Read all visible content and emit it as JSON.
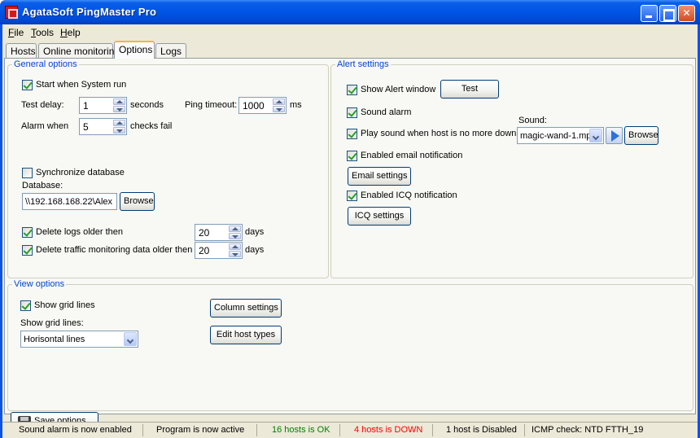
{
  "window": {
    "title": "AgataSoft PingMaster Pro"
  },
  "menu": [
    "File",
    "Tools",
    "Help"
  ],
  "tabs": [
    {
      "label": "Hosts",
      "active": false
    },
    {
      "label": "Online monitoring",
      "active": false
    },
    {
      "label": "Options",
      "active": true
    },
    {
      "label": "Logs",
      "active": false
    }
  ],
  "general": {
    "title": "General options",
    "start_when_system_run": {
      "label": "Start when System run",
      "checked": true
    },
    "test_delay": {
      "label": "Test delay:",
      "value": "1",
      "unit": "seconds"
    },
    "ping_timeout": {
      "label": "Ping timeout:",
      "value": "1000",
      "unit": "ms"
    },
    "alarm_when": {
      "label": "Alarm when",
      "value": "5",
      "unit": "checks fail"
    },
    "sync_db": {
      "label": "Synchronize database",
      "checked": false
    },
    "database": {
      "label": "Database:",
      "value": "\\\\192.168.168.22\\Alex",
      "browse": "Browse"
    },
    "delete_logs": {
      "label": "Delete logs older then",
      "checked": true,
      "value": "20",
      "unit": "days"
    },
    "delete_traffic": {
      "label": "Delete traffic monitoring data older then",
      "checked": true,
      "value": "20",
      "unit": "days"
    }
  },
  "alert": {
    "title": "Alert settings",
    "show_alert_window": {
      "label": "Show Alert window",
      "checked": true
    },
    "test_button": "Test",
    "sound_alarm": {
      "label": "Sound alarm",
      "checked": true
    },
    "play_sound": {
      "label": "Play sound when host is no more down",
      "checked": true
    },
    "sound": {
      "label": "Sound:",
      "value": "magic-wand-1.mp",
      "browse": "Browse"
    },
    "email_notification": {
      "label": "Enabled email notification",
      "checked": true
    },
    "email_settings": "Email settings",
    "icq_notification": {
      "label": "Enabled ICQ notification",
      "checked": true
    },
    "icq_settings": "ICQ settings"
  },
  "view": {
    "title": "View options",
    "show_grid_lines": {
      "label": "Show grid lines",
      "checked": true
    },
    "grid_lines_label": "Show grid lines:",
    "grid_lines_value": "Horisontal lines",
    "column_settings": "Column settings",
    "edit_host_types": "Edit host types"
  },
  "save_options": "Save options",
  "status": {
    "sound": "Sound alarm is now enabled",
    "program": "Program is now active",
    "hosts_ok": "16 hosts is OK",
    "hosts_down": "4 hosts is DOWN",
    "hosts_disabled": "1 host is Disabled",
    "icmp": "ICMP check: NTD FTTH_19"
  },
  "colors": {
    "ok": "#008000",
    "down": "#ff0000",
    "group_title": "#0046d5",
    "title_bar": "#0055e5"
  }
}
